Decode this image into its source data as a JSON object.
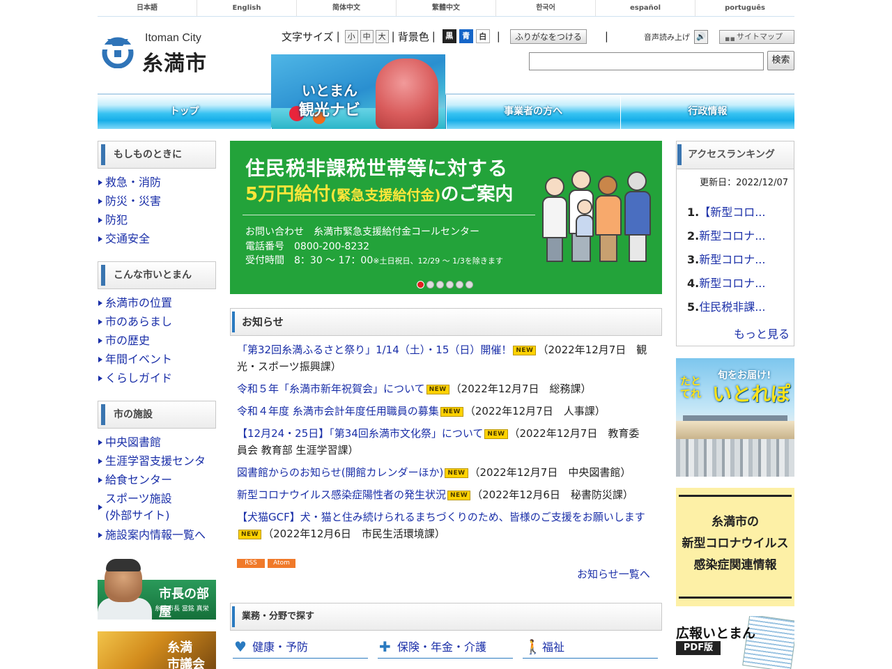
{
  "languages": [
    "日本語",
    "English",
    "简体中文",
    "繁體中文",
    "한국어",
    "español",
    "português"
  ],
  "logo": {
    "en": "Itoman City",
    "ja": "糸満市"
  },
  "util": {
    "font_size_label": "文字サイズ",
    "size_small": "小",
    "size_medium": "中",
    "size_large": "大",
    "bg_label": "背景色",
    "bg_black": "黒",
    "bg_blue": "青",
    "bg_white": "白",
    "furigana": "ふりがなをつける",
    "voice": "音声読み上げ",
    "sitemap": "サイトマップ",
    "sep": "|"
  },
  "search": {
    "value": "",
    "button": "検索"
  },
  "gnav": {
    "top": "トップ",
    "kanko_1": "いとまん",
    "kanko_2": "観光ナビ",
    "business": "事業者の方へ",
    "admin": "行政情報"
  },
  "left": {
    "sec1_title": "もしものときに",
    "sec1_items": [
      "救急・消防",
      "防災・災害",
      "防犯",
      "交通安全"
    ],
    "sec2_title": "こんな市いとまん",
    "sec2_items": [
      "糸満市の位置",
      "市のあらまし",
      "市の歴史",
      "年間イベント",
      "くらしガイド"
    ],
    "sec3_title": "市の施設",
    "sec3_items": [
      "中央図書館",
      "生涯学習支援センタ",
      "給食センター",
      "スポーツ施設\n(外部サイト)",
      "施設案内情報一覧へ"
    ],
    "mayor_title": "市長の部屋",
    "mayor_sub": "糸満市長 當銘 真栄",
    "gikai": "糸満\n市議会"
  },
  "banner": {
    "line1": "住民税非課税世帯等に対する",
    "line2_a": "5万円給付",
    "line2_b": "(緊急支援給付金)",
    "line2_c": "のご案内",
    "contact": "お問い合わせ　糸満市緊急支援給付金コールセンター",
    "phone": "電話番号　0800-200-8232",
    "hours": "受付時間　8：30 ～ 17：00",
    "hours_note": "※土日祝日、12/29 ～ 1/3を除きます",
    "dot_count": 6,
    "active_dot": 1
  },
  "news": {
    "title": "お知らせ",
    "new_label": "NEW",
    "items": [
      {
        "title": "「第32回糸満ふるさと祭り」1/14（土）・15（日）開催！",
        "meta": "（2022年12月7日　観光・スポーツ振興課）"
      },
      {
        "title": "令和５年「糸満市新年祝賀会」について",
        "meta": "（2022年12月7日　総務課）"
      },
      {
        "title": "令和４年度 糸満市会計年度任用職員の募集",
        "meta": "（2022年12月7日　人事課）"
      },
      {
        "title": "【12月24・25日】「第34回糸満市文化祭」について",
        "meta": "（2022年12月7日　教育委員会 教育部 生涯学習課）"
      },
      {
        "title": "図書館からのお知らせ(開館カレンダーほか)",
        "meta": "（2022年12月7日　中央図書館）"
      },
      {
        "title": "新型コロナウイルス感染症陽性者の発生状況",
        "meta": "（2022年12月6日　秘書防災課）"
      },
      {
        "title": "【犬猫GCF】犬・猫と住み続けられるまちづくりのため、皆様のご支援をお願いします",
        "meta": "（2022年12月6日　市民生活環境課）"
      }
    ],
    "rss": "RSS",
    "atom": "Atom",
    "more": "お知らせ一覧へ"
  },
  "fields": {
    "title": "業務・分野で探す",
    "items": [
      {
        "label": "健康・予防",
        "icon": "heart-icon"
      },
      {
        "label": "保険・年金・介護",
        "icon": "cross-icon"
      },
      {
        "label": "福祉",
        "icon": "walker-icon"
      }
    ]
  },
  "ranking": {
    "title": "アクセスランキング",
    "updated": "更新日：2022/12/07",
    "items": [
      {
        "rank": "1.",
        "label": "【新型コロ..."
      },
      {
        "rank": "2.",
        "label": "新型コロナ..."
      },
      {
        "rank": "3.",
        "label": "新型コロナ..."
      },
      {
        "rank": "4.",
        "label": "新型コロナ..."
      },
      {
        "rank": "5.",
        "label": "住民税非課..."
      }
    ],
    "more": "もっと見る"
  },
  "ads": {
    "itorepo_sub": "旬をお届け!",
    "itorepo_main": "いとれぽ",
    "itorepo_left": "たと\nてれ",
    "corona": "糸満市の\n新型コロナウイルス\n感染症関連情報",
    "koho_title": "広報いとまん",
    "koho_pdf": "PDF版"
  },
  "colors": {
    "link": "#1a2fa8",
    "banner_green": "#23a33a",
    "nav_blue": "#16aee8",
    "accent": "#3a75b0"
  }
}
